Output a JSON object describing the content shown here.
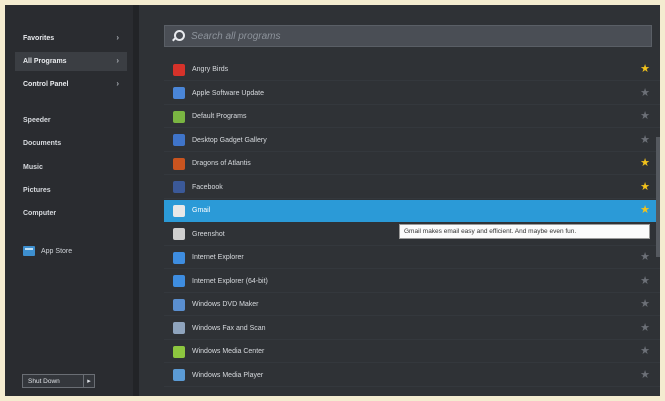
{
  "sidebar": {
    "nav": [
      {
        "label": "Favorites"
      },
      {
        "label": "All Programs"
      },
      {
        "label": "Control Panel"
      }
    ],
    "places": [
      "Speeder",
      "Documents",
      "Music",
      "Pictures",
      "Computer"
    ],
    "app_store": "App Store",
    "shutdown": "Shut Down",
    "shutdown_arrow": "▸"
  },
  "search": {
    "placeholder": "Search all programs"
  },
  "programs": [
    {
      "name": "Angry Birds",
      "icon": "angry-birds-icon",
      "color": "#d6322a",
      "favorite": true
    },
    {
      "name": "Apple Software Update",
      "icon": "apple-update-icon",
      "color": "#4a86d8",
      "favorite": false
    },
    {
      "name": "Default Programs",
      "icon": "default-programs-icon",
      "color": "#7ab542",
      "favorite": false
    },
    {
      "name": "Desktop Gadget Gallery",
      "icon": "gadget-gallery-icon",
      "color": "#3f74c9",
      "favorite": false
    },
    {
      "name": "Dragons of Atlantis",
      "icon": "dragons-icon",
      "color": "#c9541f",
      "favorite": true
    },
    {
      "name": "Facebook",
      "icon": "facebook-icon",
      "color": "#3b5998",
      "favorite": true
    },
    {
      "name": "Gmail",
      "icon": "gmail-icon",
      "color": "#e8e8e8",
      "favorite": true,
      "selected": true
    },
    {
      "name": "Greenshot",
      "icon": "greenshot-icon",
      "color": "#cfcfcf",
      "favorite": false
    },
    {
      "name": "Internet Explorer",
      "icon": "ie-icon",
      "color": "#3e8de0",
      "favorite": false
    },
    {
      "name": "Internet Explorer (64-bit)",
      "icon": "ie64-icon",
      "color": "#3e8de0",
      "favorite": false
    },
    {
      "name": "Windows DVD Maker",
      "icon": "dvd-maker-icon",
      "color": "#5a8fd0",
      "favorite": false
    },
    {
      "name": "Windows Fax and Scan",
      "icon": "fax-scan-icon",
      "color": "#8fa4bd",
      "favorite": false
    },
    {
      "name": "Windows Media Center",
      "icon": "media-center-icon",
      "color": "#8dc63f",
      "favorite": false
    },
    {
      "name": "Windows Media Player",
      "icon": "media-player-icon",
      "color": "#5b9bd5",
      "favorite": false
    }
  ],
  "tooltip": "Gmail makes email easy and efficient. And maybe even fun.",
  "colors": {
    "selection": "#2b9ad7",
    "favorite_star": "#f2c21b"
  }
}
